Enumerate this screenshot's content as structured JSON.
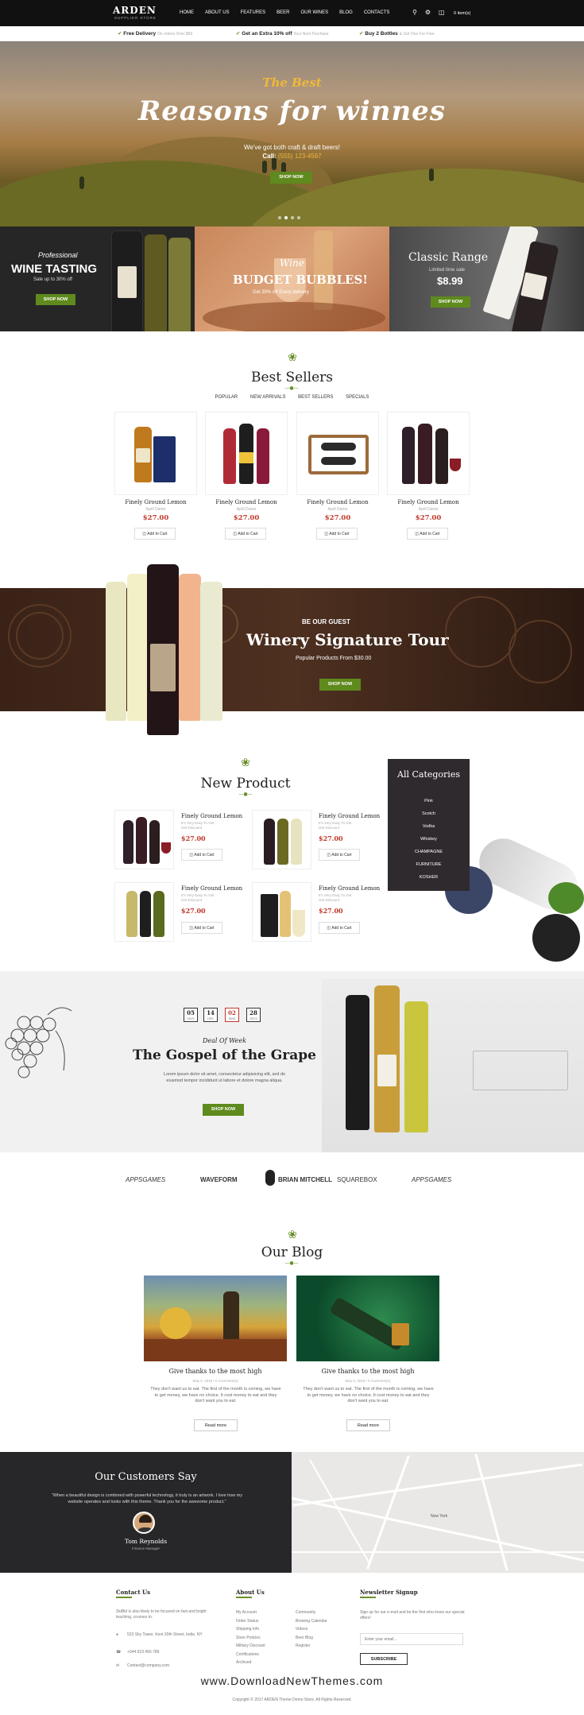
{
  "header": {
    "logo": "ARDEN",
    "logo_sub": "SUPPLIER STORE",
    "nav": [
      "HOME",
      "ABOUT US",
      "FEATURES",
      "BEER",
      "OUR WINES",
      "BLOG",
      "CONTACTS"
    ],
    "cart": "0 item(s)"
  },
  "infobar": [
    {
      "strong": "Free Delivery",
      "muted": "On orders Over $99"
    },
    {
      "strong": "Get an Extra 10% off",
      "muted": "Your Next Purchase"
    },
    {
      "strong": "Buy 2 Bottles",
      "muted": "& Get One For Free"
    }
  ],
  "hero": {
    "kicker": "The Best",
    "title": "Reasons for winnes",
    "line1": "We've got both craft & draft beers!",
    "line2_prefix": "Call:",
    "phone": "(555) 123-4567",
    "button": "SHOP NOW"
  },
  "promos": [
    {
      "kicker": "Professional",
      "title": "WINE TASTING",
      "sub": "Sale up to 30% off",
      "button": "SHOP NOW"
    },
    {
      "kicker": "Wine",
      "title": "BUDGET BUBBLES!",
      "sub": "Get 30% off Every delivery"
    },
    {
      "title": "Classic Range",
      "sub": "Limited time sale",
      "price": "$8.99",
      "button": "SHOP NOW"
    }
  ],
  "bestsellers": {
    "title": "Best Sellers",
    "tabs": [
      "POPULAR",
      "NEW ARRIVALS",
      "BEST SELLERS",
      "SPECIALS"
    ],
    "products": [
      {
        "name": "Finely Ground Lemon",
        "sub": "April Dame",
        "price": "$27.00",
        "cart": "Add to Cart"
      },
      {
        "name": "Finely Ground Lemon",
        "sub": "April Dame",
        "price": "$27.00",
        "cart": "Add to Cart"
      },
      {
        "name": "Finely Ground Lemon",
        "sub": "April Dame",
        "price": "$27.00",
        "cart": "Add to Cart"
      },
      {
        "name": "Finely Ground Lemon",
        "sub": "April Dame",
        "price": "$27.00",
        "cart": "Add to Cart"
      }
    ]
  },
  "tour": {
    "kicker": "BE OUR GUEST",
    "title": "Winery Signature Tour",
    "sub": "Popular Products From $30.00",
    "button": "SHOP NOW"
  },
  "newproduct": {
    "title": "New Product",
    "products": [
      {
        "name": "Finely Ground Lemon",
        "sub1": "It's Very Easy To Get",
        "sub2": "Get Discount",
        "price": "$27.00",
        "cart": "Add to Cart"
      },
      {
        "name": "Finely Ground Lemon",
        "sub1": "It's Very Easy To Get",
        "sub2": "Get Discount",
        "price": "$27.00",
        "cart": "Add to Cart"
      },
      {
        "name": "Finely Ground Lemon",
        "sub1": "It's Very Easy To Get",
        "sub2": "Get Discount",
        "price": "$27.00",
        "cart": "Add to Cart"
      },
      {
        "name": "Finely Ground Lemon",
        "sub1": "It's Very Easy To Get",
        "sub2": "Get Discount",
        "price": "$27.00",
        "cart": "Add to Cart"
      }
    ],
    "categories_title": "All Categories",
    "categories": [
      "Pink",
      "Scotch",
      "Vodka",
      "Whiskey",
      "CHAMPAGNE",
      "FURNITURE",
      "KOSHER"
    ]
  },
  "deal": {
    "countdown": [
      {
        "num": "05",
        "unit": "DAYS"
      },
      {
        "num": "14",
        "unit": "HRS"
      },
      {
        "num": "02",
        "unit": "MINS"
      },
      {
        "num": "28",
        "unit": "SECS"
      }
    ],
    "kicker": "Deal Of Week",
    "title": "The Gospel of the Grape",
    "desc": "Lorem ipsum dolor sit amet, consectetur adipisicing elit, sed do eiusmod tempor incididunt ut labore et dolore magna aliqua.",
    "button": "SHOP NOW"
  },
  "brands": [
    "APPSGAMES",
    "WAVEFORM",
    "BRIAN MITCHELL",
    "SQUAREBOX",
    "APPSGAMES"
  ],
  "blog": {
    "title": "Our Blog",
    "posts": [
      {
        "title": "Give thanks to the most high",
        "meta": "May 6, 2018  /  0 Comment(s)",
        "text": "They don't want us to eat. The first of the month is coming, we have to get money, we have no choice. It cost money to eat and they don't want you to eat.",
        "button": "Read more"
      },
      {
        "title": "Give thanks to the most high",
        "meta": "May 6, 2018  /  0 Comment(s)",
        "text": "They don't want us to eat. The first of the month is coming, we have to get money, we have no choice. It cost money to eat and they don't want you to eat.",
        "button": "Read more"
      }
    ]
  },
  "testimonial": {
    "title": "Our Customers Say",
    "quote": "“When a beautiful design is combined with powerful technology, it truly is an artwork. I love how my website operates and looks with this theme. Thank you for the awesome product.”",
    "name": "Tom Reynolds",
    "role": "Finance Manager"
  },
  "map_label": "New York",
  "footer": {
    "contact_title": "Contact Us",
    "contact_text": "SkiBid is also likely to be focused on fast and bright teaching, courses to.",
    "address": "523 Sky Tower, Kent 20th Street, Indie, NY",
    "phone": "+044 523 456 789",
    "email": "Contact@company.com",
    "about_title": "About Us",
    "about_col1": [
      "My Account",
      "Order Status",
      "Shipping Info",
      "Store Policies",
      "Military Discount",
      "Certifications",
      "Archived"
    ],
    "about_col2": [
      "Community",
      "Brewing Calendar",
      "Videos",
      "Beer Blog",
      "Register"
    ],
    "news_title": "Newsletter Signup",
    "news_text": "Sign up for our e-mail and be the first who know our special offers!",
    "news_placeholder": "Enter your email...",
    "news_button": "SUBSCRIBE",
    "watermark": "www.DownloadNewThemes.com",
    "copyright": "Copyright © 2017 ARDEN Theme Demo Store. All Rights Reserved."
  },
  "colors": {
    "accent": "#5f8a1e",
    "price": "#c0392b",
    "dark": "#111111"
  }
}
